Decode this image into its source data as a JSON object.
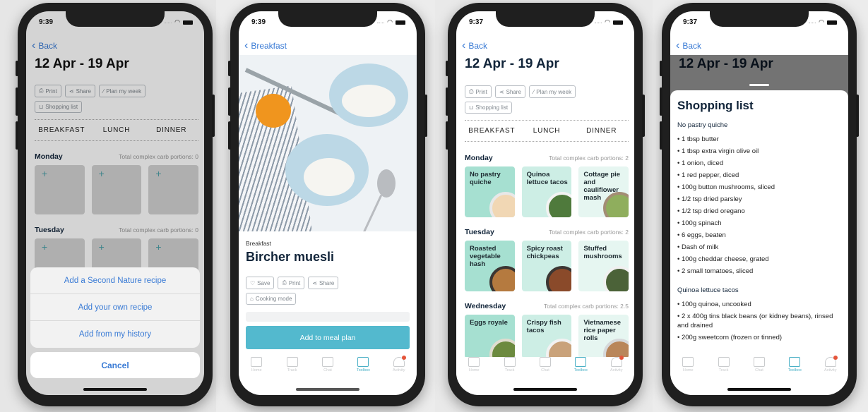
{
  "colors": {
    "accent_blue": "#3a7bd5",
    "teal": "#53b9ce",
    "card_dark_mint": "#a6e0d1",
    "card_mid_mint": "#cdeee5",
    "card_light_mint": "#e6f6f1",
    "title_navy": "#12253a",
    "notification_red": "#e5553a"
  },
  "tabbar": {
    "items": [
      {
        "label": "Home",
        "icon": "home-icon"
      },
      {
        "label": "Track",
        "icon": "chart-line-icon"
      },
      {
        "label": "Chat",
        "icon": "chat-bubble-icon"
      },
      {
        "label": "Toolbox",
        "icon": "book-icon"
      },
      {
        "label": "Activity",
        "icon": "bell-icon"
      }
    ]
  },
  "screens": [
    {
      "status_time": "9:39",
      "back_label": "Back",
      "title": "12 Apr - 19 Apr",
      "actions": [
        "Print",
        "Share",
        "Plan my week",
        "Shopping list"
      ],
      "meal_columns": [
        "BREAKFAST",
        "LUNCH",
        "DINNER"
      ],
      "days": [
        {
          "name": "Monday",
          "carb_text": "Total complex carb portions: 0"
        },
        {
          "name": "Tuesday",
          "carb_text": "Total complex carb portions: 0"
        }
      ],
      "add_symbol": "+",
      "action_sheet": {
        "options": [
          "Add a Second Nature recipe",
          "Add your own recipe",
          "Add from my history"
        ],
        "cancel": "Cancel"
      }
    },
    {
      "status_time": "9:39",
      "back_label": "Breakfast",
      "category": "Breakfast",
      "title": "Bircher muesli",
      "actions": [
        "Save",
        "Print",
        "Share",
        "Cooking mode"
      ],
      "cta": "Add to meal plan"
    },
    {
      "status_time": "9:37",
      "back_label": "Back",
      "title": "12 Apr - 19 Apr",
      "actions": [
        "Print",
        "Share",
        "Plan my week",
        "Shopping list"
      ],
      "meal_columns": [
        "BREAKFAST",
        "LUNCH",
        "DINNER"
      ],
      "days": [
        {
          "name": "Monday",
          "carb_text": "Total complex carb portions: 2",
          "meals": [
            "No pastry quiche",
            "Quinoa lettuce tacos",
            "Cottage pie and cauliflower mash"
          ]
        },
        {
          "name": "Tuesday",
          "carb_text": "Total complex carb portions: 2",
          "meals": [
            "Roasted vegetable hash",
            "Spicy roast chickpeas",
            "Stuffed mushrooms"
          ]
        },
        {
          "name": "Wednesday",
          "carb_text": "Total complex carb portions: 2.5",
          "meals": [
            "Eggs royale",
            "Crispy fish tacos",
            "Vietnamese rice paper rolls"
          ]
        }
      ]
    },
    {
      "status_time": "9:37",
      "back_label": "Back",
      "title": "12 Apr - 19 Apr",
      "sheet_title": "Shopping list",
      "recipes": [
        {
          "name": "No pastry quiche",
          "items": [
            "• 1 tbsp butter",
            "• 1 tbsp extra virgin olive oil",
            "• 1 onion, diced",
            "• 1 red pepper, diced",
            "• 100g button mushrooms, sliced",
            "• 1/2 tsp dried parsley",
            "• 1/2 tsp dried oregano",
            "• 100g spinach",
            "• 6 eggs, beaten",
            "• Dash of milk",
            "• 100g cheddar cheese, grated",
            "• 2 small tomatoes, sliced"
          ]
        },
        {
          "name": "Quinoa lettuce tacos",
          "items": [
            "• 100g quinoa, uncooked",
            "• 2 x 400g tins black beans (or kidney beans), rinsed and drained",
            "• 200g sweetcorn (frozen or tinned)"
          ]
        }
      ]
    }
  ]
}
